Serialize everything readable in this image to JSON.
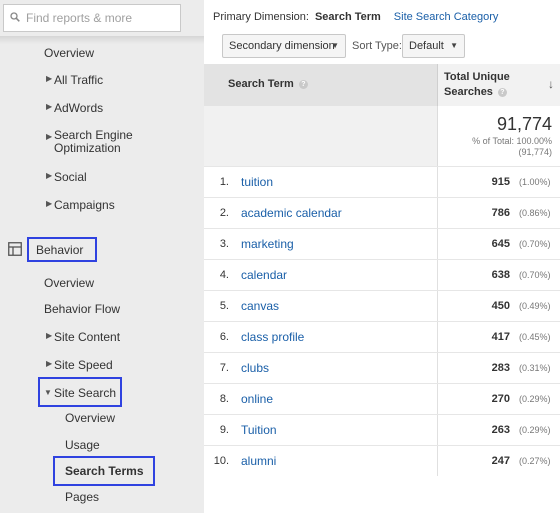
{
  "sidebar": {
    "search_placeholder": "Find reports & more",
    "acquisition": {
      "overview": "Overview",
      "all_traffic": "All Traffic",
      "adwords": "AdWords",
      "seo": "Search Engine Optimization",
      "social": "Social",
      "campaigns": "Campaigns"
    },
    "behavior": {
      "label": "Behavior",
      "overview": "Overview",
      "behavior_flow": "Behavior Flow",
      "site_content": "Site Content",
      "site_speed": "Site Speed",
      "site_search": "Site Search",
      "site_search_children": {
        "overview": "Overview",
        "usage": "Usage",
        "search_terms": "Search Terms",
        "pages": "Pages"
      }
    },
    "highlight_color": "#2f42e0"
  },
  "toolbar": {
    "primary_dimension_label": "Primary Dimension:",
    "primary_active": "Search Term",
    "primary_alt": "Site Search Category",
    "secondary_dimension": "Secondary dimension",
    "sort_type_label": "Sort Type:",
    "sort_type_value": "Default"
  },
  "table": {
    "col_term": "Search Term",
    "col_metric_line1": "Total Unique",
    "col_metric_line2": "Searches",
    "total_value": "91,774",
    "total_pct_line1": "% of Total: 100.00%",
    "total_pct_line2": "(91,774)",
    "rows": [
      {
        "idx": "1.",
        "term": "tuition",
        "value": "915",
        "pct": "(1.00%)"
      },
      {
        "idx": "2.",
        "term": "academic calendar",
        "value": "786",
        "pct": "(0.86%)"
      },
      {
        "idx": "3.",
        "term": "marketing",
        "value": "645",
        "pct": "(0.70%)"
      },
      {
        "idx": "4.",
        "term": "calendar",
        "value": "638",
        "pct": "(0.70%)"
      },
      {
        "idx": "5.",
        "term": "canvas",
        "value": "450",
        "pct": "(0.49%)"
      },
      {
        "idx": "6.",
        "term": "class profile",
        "value": "417",
        "pct": "(0.45%)"
      },
      {
        "idx": "7.",
        "term": "clubs",
        "value": "283",
        "pct": "(0.31%)"
      },
      {
        "idx": "8.",
        "term": "online",
        "value": "270",
        "pct": "(0.29%)"
      },
      {
        "idx": "9.",
        "term": "Tuition",
        "value": "263",
        "pct": "(0.29%)"
      },
      {
        "idx": "10.",
        "term": "alumni",
        "value": "247",
        "pct": "(0.27%)"
      }
    ]
  }
}
